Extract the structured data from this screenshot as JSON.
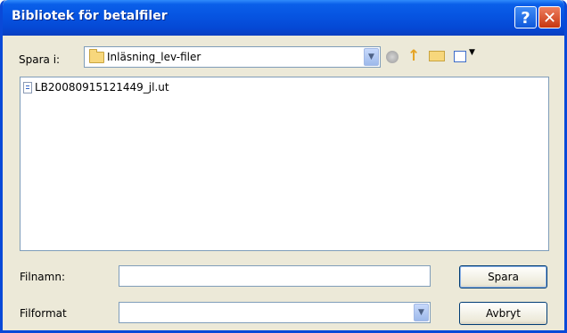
{
  "window": {
    "title": "Bibliotek för betalfiler",
    "help_label": "?",
    "close_label": "✕"
  },
  "toolbar": {
    "look_in_label": "Spara i:",
    "look_in_value": "Inläsning_lev-filer",
    "icons": [
      "back-icon",
      "up-folder-icon",
      "new-folder-icon",
      "view-menu-icon"
    ]
  },
  "files": [
    {
      "name": "LB20080915121449_jl.ut",
      "icon": "document-icon"
    }
  ],
  "form": {
    "filename_label": "Filnamn:",
    "filename_value": "",
    "format_label": "Filformat",
    "format_value": ""
  },
  "buttons": {
    "save": "Spara",
    "cancel": "Avbryt"
  },
  "colors": {
    "titlebar": "#0654e1",
    "dialog_bg": "#ece9d8",
    "close_button": "#c7350f"
  }
}
